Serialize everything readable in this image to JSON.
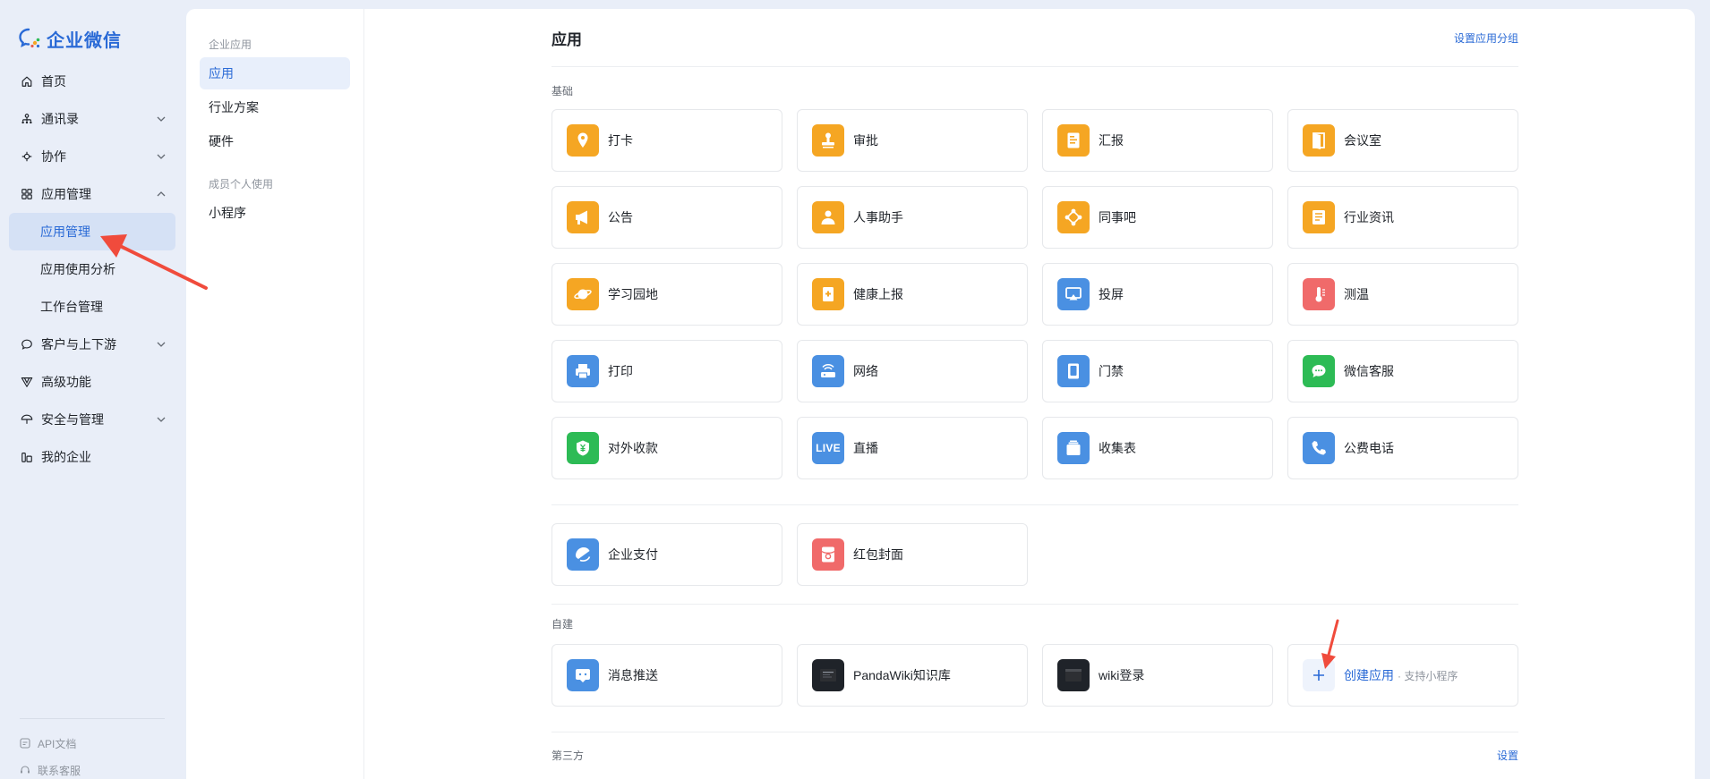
{
  "brand": {
    "name": "企业微信",
    "color": "#2a6ad6"
  },
  "sidebar": {
    "items": [
      {
        "label": "首页",
        "icon": "home-icon",
        "chevron": false
      },
      {
        "label": "通讯录",
        "icon": "contacts-icon",
        "chevron": "down"
      },
      {
        "label": "协作",
        "icon": "collab-icon",
        "chevron": "down"
      },
      {
        "label": "应用管理",
        "icon": "apps-icon",
        "chevron": "up"
      },
      {
        "label": "应用管理",
        "sub": true,
        "active": true
      },
      {
        "label": "应用使用分析",
        "sub": true
      },
      {
        "label": "工作台管理",
        "sub": true
      },
      {
        "label": "客户与上下游",
        "icon": "chat-icon",
        "chevron": "down"
      },
      {
        "label": "高级功能",
        "icon": "advanced-icon",
        "chevron": false
      },
      {
        "label": "安全与管理",
        "icon": "umbrella-icon",
        "chevron": "down"
      },
      {
        "label": "我的企业",
        "icon": "company-icon",
        "chevron": false
      }
    ],
    "footer": [
      {
        "label": "API文档",
        "icon": "api-doc-icon"
      },
      {
        "label": "联系客服",
        "icon": "support-icon"
      }
    ]
  },
  "subnav": {
    "group1": "企业应用",
    "items1": [
      "应用",
      "行业方案",
      "硬件"
    ],
    "group2": "成员个人使用",
    "items2": [
      "小程序"
    ]
  },
  "main": {
    "title": "应用",
    "set_group_link": "设置应用分组",
    "basic_label": "基础",
    "basic_apps": [
      {
        "name": "打卡",
        "icon": "location-pin-icon",
        "color": "#f5a623"
      },
      {
        "name": "审批",
        "icon": "stamp-icon",
        "color": "#f5a623"
      },
      {
        "name": "汇报",
        "icon": "report-icon",
        "color": "#f5a623"
      },
      {
        "name": "会议室",
        "icon": "door-icon",
        "color": "#f5a623"
      },
      {
        "name": "公告",
        "icon": "megaphone-icon",
        "color": "#f5a623"
      },
      {
        "name": "人事助手",
        "icon": "person-icon",
        "color": "#f5a623"
      },
      {
        "name": "同事吧",
        "icon": "network-icon",
        "color": "#f5a623"
      },
      {
        "name": "行业资讯",
        "icon": "news-icon",
        "color": "#f5a623"
      },
      {
        "name": "学习园地",
        "icon": "planet-icon",
        "color": "#f5a623"
      },
      {
        "name": "健康上报",
        "icon": "health-icon",
        "color": "#f5a623"
      },
      {
        "name": "投屏",
        "icon": "cast-icon",
        "color": "#4a90e2"
      },
      {
        "name": "测温",
        "icon": "thermometer-icon",
        "color": "#f06a6a"
      },
      {
        "name": "打印",
        "icon": "printer-icon",
        "color": "#4a90e2"
      },
      {
        "name": "网络",
        "icon": "router-icon",
        "color": "#4a90e2"
      },
      {
        "name": "门禁",
        "icon": "gate-icon",
        "color": "#4a90e2"
      },
      {
        "name": "微信客服",
        "icon": "wechat-service-icon",
        "color": "#2dbb55"
      },
      {
        "name": "对外收款",
        "icon": "yuan-shield-icon",
        "color": "#2dbb55"
      },
      {
        "name": "直播",
        "icon": "live-icon",
        "color": "#4a90e2",
        "icon_text": "LIVE"
      },
      {
        "name": "收集表",
        "icon": "form-icon",
        "color": "#4a90e2"
      },
      {
        "name": "公费电话",
        "icon": "phone-icon",
        "color": "#4a90e2"
      }
    ],
    "pay_apps": [
      {
        "name": "企业支付",
        "icon": "pay-icon",
        "color": "#4a90e2"
      },
      {
        "name": "红包封面",
        "icon": "red-packet-icon",
        "color": "#f06a6a"
      }
    ],
    "custom_label": "自建",
    "custom_apps": [
      {
        "name": "消息推送",
        "icon": "message-push-icon",
        "color": "#4a90e2"
      },
      {
        "name": "PandaWiki知识库",
        "icon": "pandawiki-icon",
        "color": "#1f2329"
      },
      {
        "name": "wiki登录",
        "icon": "wiki-login-icon",
        "color": "#1f2329"
      }
    ],
    "create_app": {
      "label": "创建应用",
      "sub": "· 支持小程序"
    },
    "third_label": "第三方",
    "third_link": "设置"
  }
}
